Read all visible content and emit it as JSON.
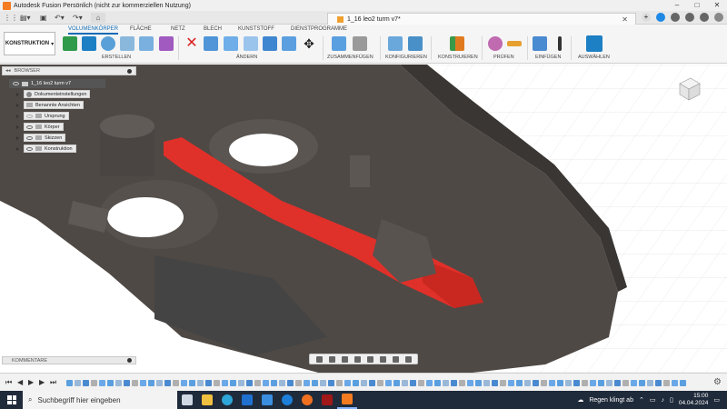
{
  "window": {
    "title": "Autodesk Fusion Persönlich (nicht zur kommerziellen Nutzung)",
    "controls": [
      "–",
      "□",
      "✕"
    ]
  },
  "doc_tab": {
    "title": "1_16 leo2 turm v7*"
  },
  "toolbar": {
    "workspace": "KONSTRUKTION",
    "ribbon_tabs": [
      "VOLUMENKÖRPER",
      "FLÄCHE",
      "NETZ",
      "BLECH",
      "KUNSTSTOFF",
      "DIENSTPROGRAMME"
    ],
    "groups": [
      "ERSTELLEN",
      "ÄNDERN",
      "ZUSAMMENFÜGEN",
      "KONFIGURIEREN",
      "KONSTRUIEREN",
      "PRÜFEN",
      "EINFÜGEN",
      "AUSWÄHLEN"
    ]
  },
  "browser": {
    "title": "BROWSER",
    "root": "1_16 leo2 turm v7",
    "items": [
      "Dokumenteinstellungen",
      "Benannte Ansichten",
      "Ursprung",
      "Körper",
      "Skizzen",
      "Konstruktion"
    ]
  },
  "comments": {
    "title": "KOMMENTARE"
  },
  "taskbar": {
    "search_placeholder": "Suchbegriff hier eingeben",
    "weather": "Regen klingt ab",
    "time": "15:00",
    "date": "04.04.2024"
  },
  "colors": {
    "accent": "#0f6ab4",
    "model_gray": "#4e4945",
    "model_red": "#e0302a",
    "taskbar": "#1f2a3a"
  }
}
